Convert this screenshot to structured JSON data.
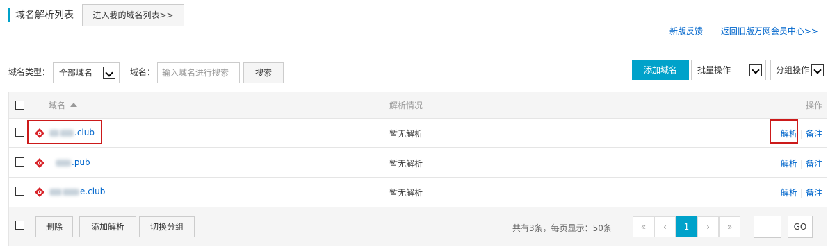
{
  "header": {
    "title": "域名解析列表",
    "enter_button": "进入我的域名列表>>",
    "links": [
      "新版反馈",
      "返回旧版万网会员中心>>"
    ]
  },
  "filter": {
    "type_label": "域名类型：",
    "type_value": "全部域名",
    "domain_label": "域名：",
    "search_placeholder": "输入域名进行搜索",
    "search_button": "搜索"
  },
  "actions": {
    "add_domain": "添加域名",
    "batch_select": "批量操作",
    "group_select": "分组操作"
  },
  "table": {
    "columns": {
      "domain": "域名",
      "sort_icon": "sort-asc-icon",
      "status": "解析情况",
      "operation": "操作"
    },
    "rows": [
      {
        "domain_suffix": ".club",
        "status": "暂无解析",
        "op_resolve": "解析",
        "op_record": "备注"
      },
      {
        "domain_suffix": ".pub",
        "status": "暂无解析",
        "op_resolve": "解析",
        "op_record": "备注"
      },
      {
        "domain_suffix": "e.club",
        "status": "暂无解析",
        "op_resolve": "解析",
        "op_record": "备注"
      }
    ]
  },
  "footer": {
    "delete": "删除",
    "add_resolve": "添加解析",
    "switch_group": "切换分组",
    "page_info": "共有3条，每页显示：50条",
    "pager": {
      "first": "«",
      "prev": "‹",
      "current": "1",
      "next": "›",
      "last": "»"
    },
    "go": "GO"
  },
  "colors": {
    "primary": "#00a2ca",
    "link": "#0066cc",
    "highlight": "#cc1a1a",
    "domain_icon": "#d8242a"
  }
}
